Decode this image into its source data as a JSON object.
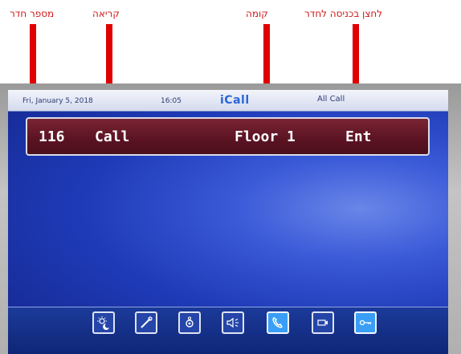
{
  "annotations": [
    {
      "text": "מספר חדר",
      "name": "annotation-room-number"
    },
    {
      "text": "קריאה",
      "name": "annotation-call"
    },
    {
      "text": "קומה",
      "name": "annotation-floor"
    },
    {
      "text": "לחצן בכניסה לחדר",
      "name": "annotation-entry-button"
    }
  ],
  "topbar": {
    "date": "Fri, January 5, 2018",
    "time": "16:05",
    "logo": "iCall",
    "mode": "All Call"
  },
  "call": {
    "room": "116",
    "type": "Call",
    "floor": "Floor 1",
    "location": "Ent"
  },
  "toolbar": [
    {
      "icon": "day-night-icon",
      "active": false
    },
    {
      "icon": "tools-icon",
      "active": false
    },
    {
      "icon": "settings-icon",
      "active": false
    },
    {
      "icon": "speaker-icon",
      "active": false
    },
    {
      "icon": "phone-icon",
      "active": true
    },
    {
      "icon": "camera-icon",
      "active": false
    },
    {
      "icon": "key-icon",
      "active": true
    }
  ],
  "colors": {
    "annotation": "#d01818",
    "arrow": "#e00000",
    "callbar": "#5a1322",
    "screen": "#1f3bb8"
  }
}
